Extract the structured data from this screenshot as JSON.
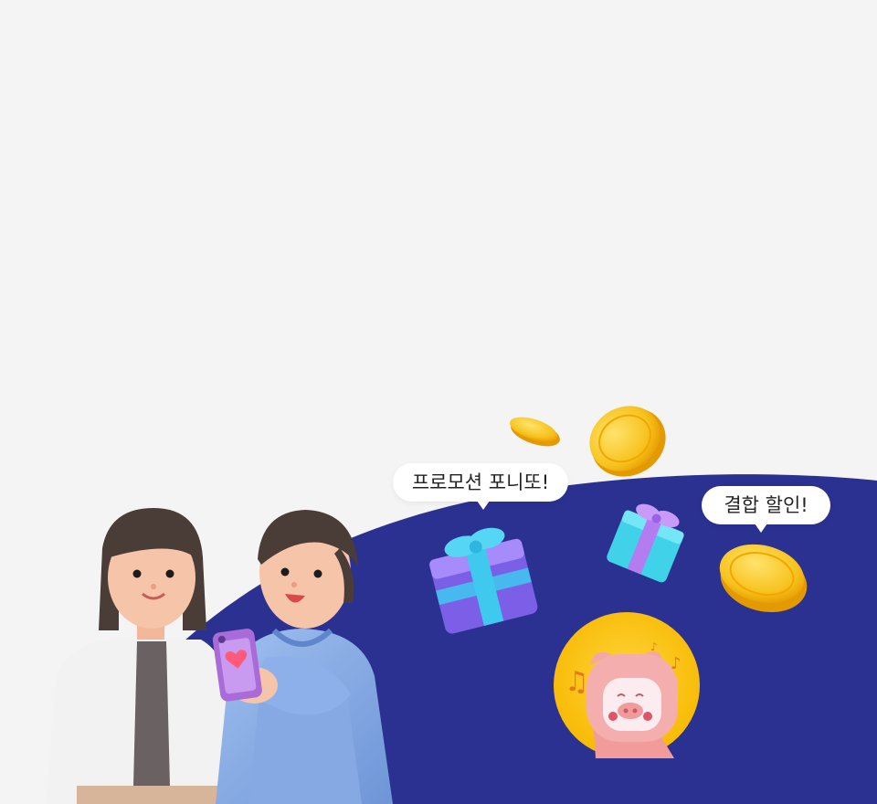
{
  "bubbles": {
    "promotion": "프로모션 포니또!",
    "bundle_discount": "결합 할인!"
  },
  "colors": {
    "background": "#f4f4f4",
    "wave": "#2b3191",
    "coin": "#f7c21e",
    "gift_purple": "#8a6cf0",
    "gift_cyan": "#39d0f2",
    "pig_pink": "#f3a7a7"
  },
  "icons": [
    "coin-icon",
    "gift-icon",
    "pig-mascot-icon",
    "music-note-icon",
    "heart-icon"
  ]
}
